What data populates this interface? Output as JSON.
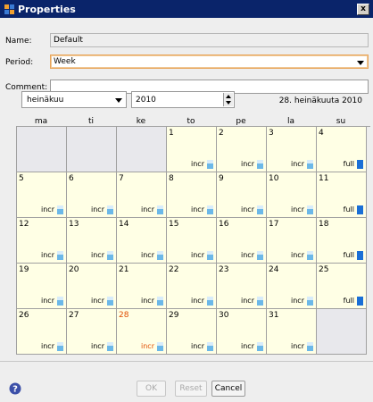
{
  "window": {
    "title": "Properties",
    "close_label": "x"
  },
  "form": {
    "name_label": "Name:",
    "name_value": "Default",
    "period_label": "Period:",
    "period_value": "Week",
    "comment_label": "Comment:",
    "comment_value": ""
  },
  "calendar": {
    "month": "heinäkuu",
    "year": "2010",
    "current_date_text": "28. heinäkuuta 2010",
    "weekdays": [
      "ma",
      "ti",
      "ke",
      "to",
      "pe",
      "la",
      "su"
    ],
    "weeks": [
      [
        null,
        null,
        null,
        {
          "day": "1",
          "backup": "incr"
        },
        {
          "day": "2",
          "backup": "incr"
        },
        {
          "day": "3",
          "backup": "incr"
        },
        {
          "day": "4",
          "backup": "full"
        }
      ],
      [
        {
          "day": "5",
          "backup": "incr"
        },
        {
          "day": "6",
          "backup": "incr"
        },
        {
          "day": "7",
          "backup": "incr"
        },
        {
          "day": "8",
          "backup": "incr"
        },
        {
          "day": "9",
          "backup": "incr"
        },
        {
          "day": "10",
          "backup": "incr"
        },
        {
          "day": "11",
          "backup": "full"
        }
      ],
      [
        {
          "day": "12",
          "backup": "incr"
        },
        {
          "day": "13",
          "backup": "incr"
        },
        {
          "day": "14",
          "backup": "incr"
        },
        {
          "day": "15",
          "backup": "incr"
        },
        {
          "day": "16",
          "backup": "incr"
        },
        {
          "day": "17",
          "backup": "incr"
        },
        {
          "day": "18",
          "backup": "full"
        }
      ],
      [
        {
          "day": "19",
          "backup": "incr"
        },
        {
          "day": "20",
          "backup": "incr"
        },
        {
          "day": "21",
          "backup": "incr"
        },
        {
          "day": "22",
          "backup": "incr"
        },
        {
          "day": "23",
          "backup": "incr"
        },
        {
          "day": "24",
          "backup": "incr"
        },
        {
          "day": "25",
          "backup": "full"
        }
      ],
      [
        {
          "day": "26",
          "backup": "incr"
        },
        {
          "day": "27",
          "backup": "incr"
        },
        {
          "day": "28",
          "backup": "incr",
          "today": true
        },
        {
          "day": "29",
          "backup": "incr"
        },
        {
          "day": "30",
          "backup": "incr"
        },
        {
          "day": "31",
          "backup": "incr"
        },
        null
      ]
    ]
  },
  "buttons": {
    "ok": "OK",
    "reset": "Reset",
    "cancel": "Cancel"
  },
  "colors": {
    "titlebar": "#0a246a",
    "cell_bg": "#ffffe5",
    "empty_cell_bg": "#e8e8ec",
    "today": "#e04d00",
    "incr_icon": "#6cb8e8",
    "full_icon": "#1a6fd6"
  }
}
